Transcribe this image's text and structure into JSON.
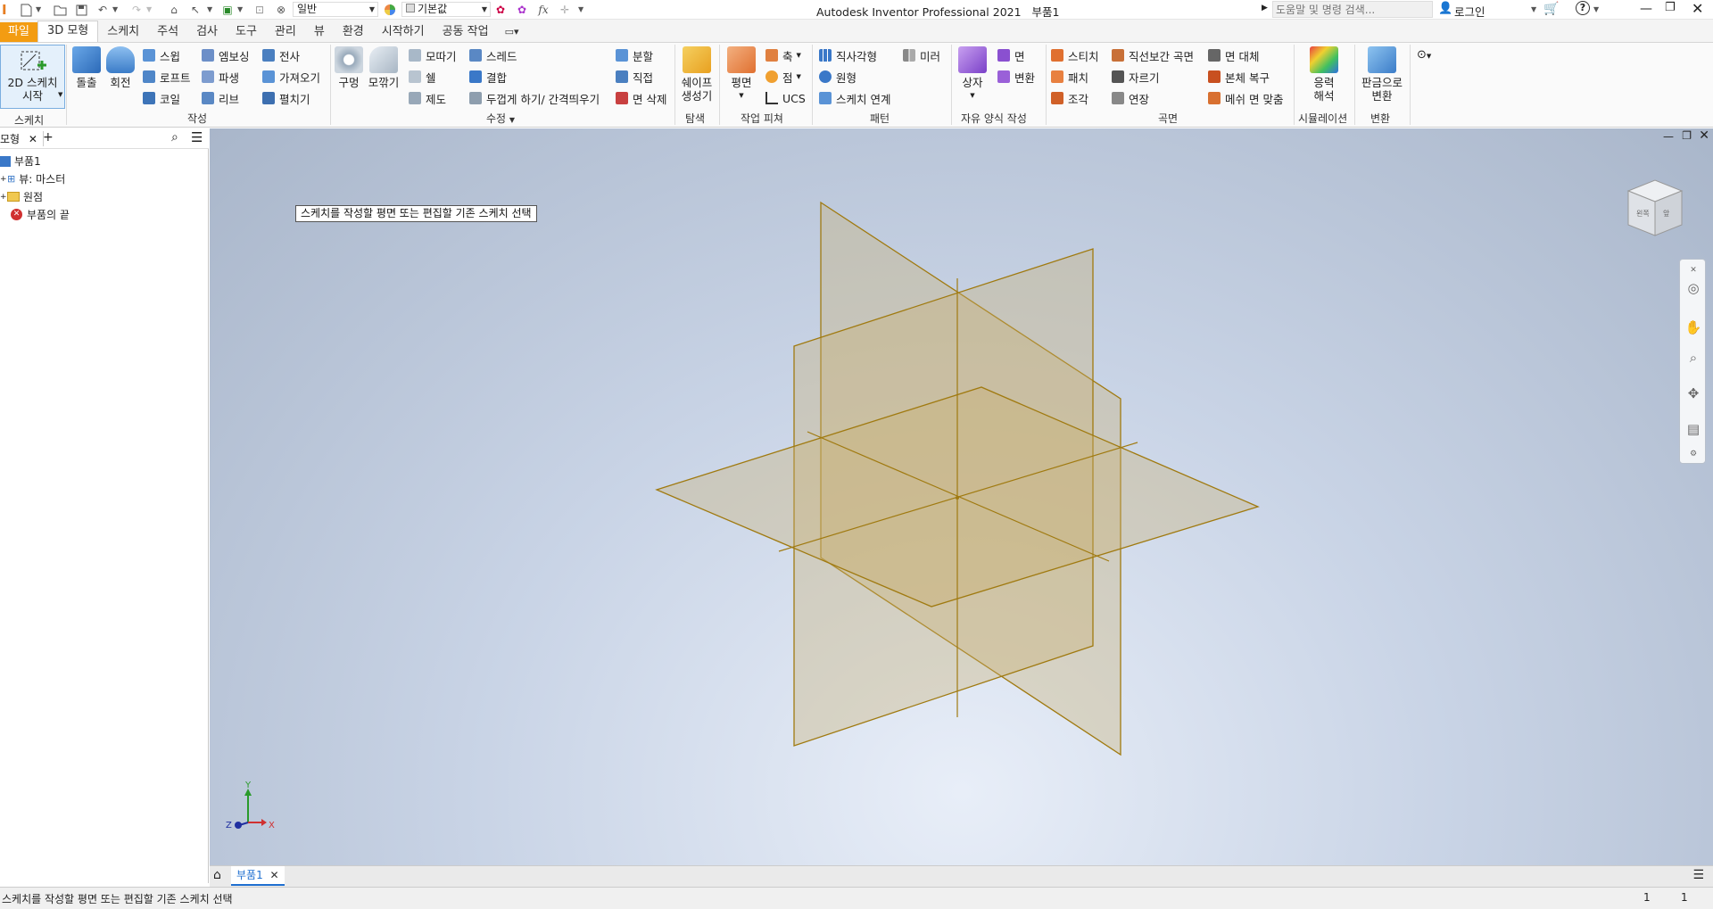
{
  "app": {
    "title": "Autodesk Inventor Professional 2021",
    "doc": "부품1"
  },
  "quick_access": {
    "appearance_combo": "일반",
    "material_combo": "기본값",
    "formula": "fx"
  },
  "search": {
    "placeholder": "도움말 및 명령 검색..."
  },
  "user": {
    "login": "로그인"
  },
  "ribbon_tabs": [
    "파일",
    "3D 모형",
    "스케치",
    "주석",
    "검사",
    "도구",
    "관리",
    "뷰",
    "환경",
    "시작하기",
    "공동 작업"
  ],
  "ribbon": {
    "sketch": {
      "start_line1": "2D 스케치",
      "start_line2": "시작",
      "panel": "스케치"
    },
    "create": {
      "extrude": "돌출",
      "revolve": "회전",
      "sweep": "스윕",
      "loft": "로프트",
      "coil": "코일",
      "emboss": "엠보싱",
      "derive": "파생",
      "rib": "리브",
      "decal": "전사",
      "import": "가져오기",
      "unfold": "펼치기",
      "panel": "작성"
    },
    "modify": {
      "hole": "구멍",
      "fillet": "모깎기",
      "chamfer": "모따기",
      "shell": "쉘",
      "draft": "제도",
      "thread": "스레드",
      "combine": "결합",
      "thicken": "두껍게 하기/ 간격띄우기",
      "split": "분할",
      "direct": "직접",
      "delete_face": "면 삭제",
      "panel": "수정"
    },
    "explore": {
      "shape_gen_line1": "쉐이프",
      "shape_gen_line2": "생성기",
      "panel": "탐색"
    },
    "work": {
      "plane": "평면",
      "axis": "축",
      "point": "점",
      "ucs": "UCS",
      "panel": "작업 피쳐"
    },
    "pattern": {
      "rect": "직사각형",
      "circ": "원형",
      "sketch_driven": "스케치 연계",
      "mirror": "미러",
      "panel": "패턴"
    },
    "freeform": {
      "box": "상자",
      "face": "면",
      "convert": "변환",
      "panel": "자유 양식 작성"
    },
    "surface": {
      "stitch": "스티치",
      "patch": "패치",
      "sculpt": "조각",
      "ruled": "직선보간 곡면",
      "trim": "자르기",
      "extend": "연장",
      "replace": "면 대체",
      "repair": "본체 복구",
      "fit_mesh": "메쉬 면 맞춤",
      "panel": "곡면"
    },
    "sim": {
      "stress_line1": "응력",
      "stress_line2": "해석",
      "panel": "시뮬레이션"
    },
    "convert": {
      "sheet_line1": "판금으로",
      "sheet_line2": "변환",
      "panel": "변환"
    }
  },
  "browser": {
    "tab": "모형",
    "tree": [
      {
        "label": "부품1"
      },
      {
        "label": "뷰: 마스터"
      },
      {
        "label": "원점"
      },
      {
        "label": "부품의 끝"
      }
    ]
  },
  "viewport": {
    "tooltip": "스케치를 작성할 평면 또는 편집할 기존 스케치 선택",
    "triad": {
      "x": "X",
      "y": "Y",
      "z": "Z"
    },
    "viewcube_labels": [
      "왼쪽",
      "앞"
    ]
  },
  "doc_tabs": [
    {
      "label": "부품1"
    }
  ],
  "status": {
    "message": "스케치를 작성할 평면 또는 편집할 기존 스케치 선택",
    "count1": "1",
    "count2": "1"
  },
  "colors": {
    "file_tab": "#f39c12",
    "plane_fill": "#c8b070",
    "plane_edge": "#a07a10",
    "accent_blue": "#1f6fd0"
  }
}
